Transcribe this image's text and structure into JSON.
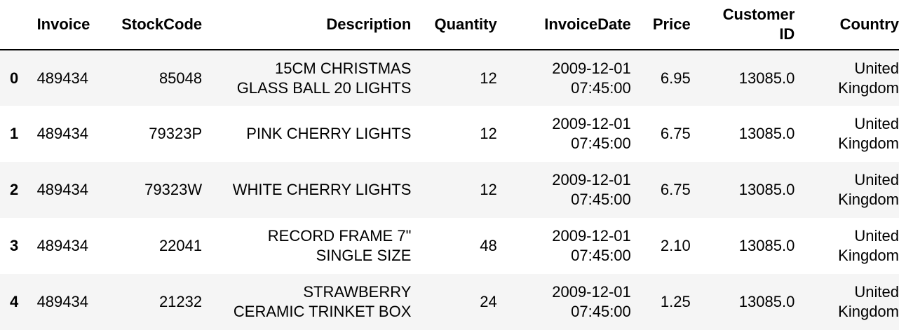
{
  "table": {
    "columns": {
      "invoice": "Invoice",
      "stock_code": "StockCode",
      "description": "Description",
      "quantity": "Quantity",
      "invoice_date": "InvoiceDate",
      "price": "Price",
      "customer_id_line1": "Customer",
      "customer_id_line2": "ID",
      "country": "Country"
    },
    "rows": [
      {
        "index": "0",
        "invoice": "489434",
        "stock_code": "85048",
        "description_line1": "15CM CHRISTMAS",
        "description_line2": "GLASS BALL 20 LIGHTS",
        "quantity": "12",
        "date_line1": "2009-12-01",
        "date_line2": "07:45:00",
        "price": "6.95",
        "customer_id": "13085.0",
        "country_line1": "United",
        "country_line2": "Kingdom"
      },
      {
        "index": "1",
        "invoice": "489434",
        "stock_code": "79323P",
        "description_line1": "PINK CHERRY LIGHTS",
        "description_line2": "",
        "quantity": "12",
        "date_line1": "2009-12-01",
        "date_line2": "07:45:00",
        "price": "6.75",
        "customer_id": "13085.0",
        "country_line1": "United",
        "country_line2": "Kingdom"
      },
      {
        "index": "2",
        "invoice": "489434",
        "stock_code": "79323W",
        "description_line1": "WHITE CHERRY LIGHTS",
        "description_line2": "",
        "quantity": "12",
        "date_line1": "2009-12-01",
        "date_line2": "07:45:00",
        "price": "6.75",
        "customer_id": "13085.0",
        "country_line1": "United",
        "country_line2": "Kingdom"
      },
      {
        "index": "3",
        "invoice": "489434",
        "stock_code": "22041",
        "description_line1": "RECORD FRAME 7\"",
        "description_line2": "SINGLE SIZE",
        "quantity": "48",
        "date_line1": "2009-12-01",
        "date_line2": "07:45:00",
        "price": "2.10",
        "customer_id": "13085.0",
        "country_line1": "United",
        "country_line2": "Kingdom"
      },
      {
        "index": "4",
        "invoice": "489434",
        "stock_code": "21232",
        "description_line1": "STRAWBERRY",
        "description_line2": "CERAMIC TRINKET BOX",
        "quantity": "24",
        "date_line1": "2009-12-01",
        "date_line2": "07:45:00",
        "price": "1.25",
        "customer_id": "13085.0",
        "country_line1": "United",
        "country_line2": "Kingdom"
      }
    ]
  },
  "colors": {
    "stripe": "#f5f5f5",
    "header_rule": "#000000",
    "background": "#ffffff"
  }
}
